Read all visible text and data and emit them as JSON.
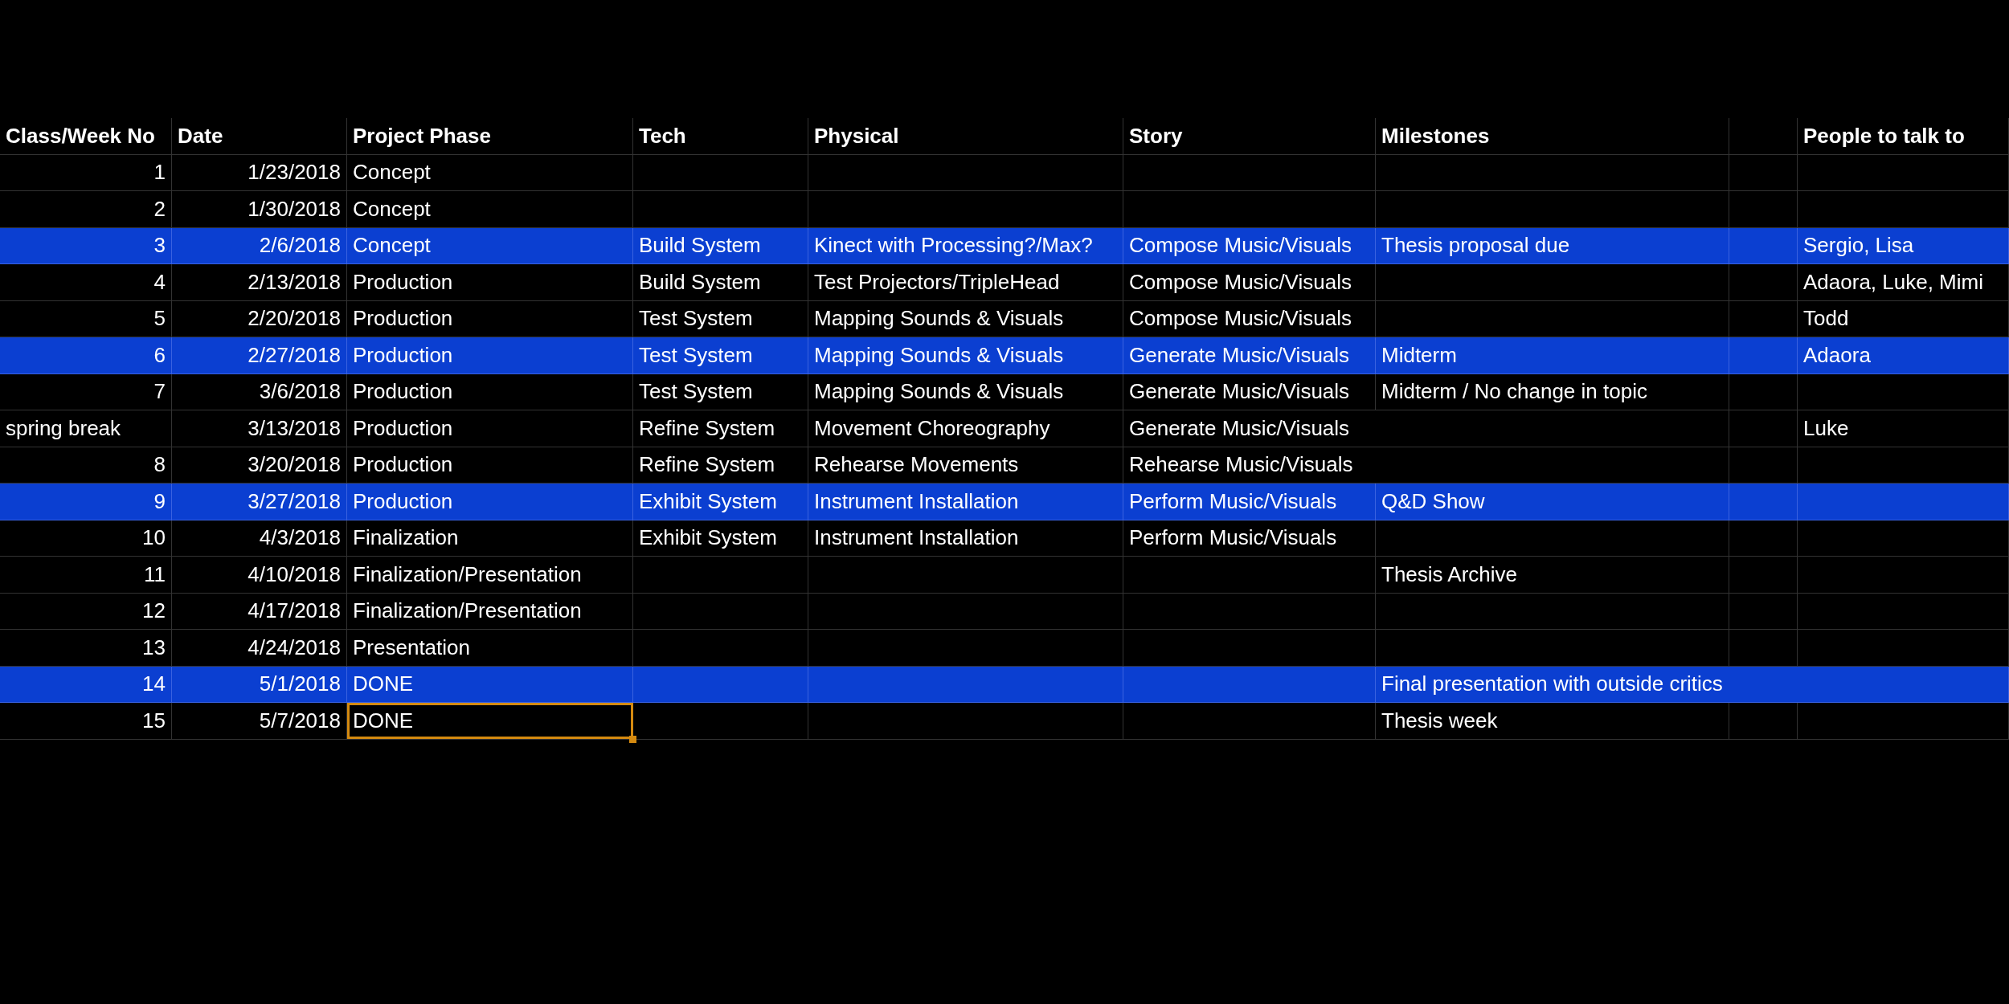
{
  "table": {
    "columns": [
      "Class/Week No",
      "Date",
      "Project Phase",
      "Tech",
      "Physical",
      "Story",
      "Milestones",
      "People to talk to"
    ],
    "rows": [
      {
        "kind": "week",
        "week": "1",
        "date": "1/23/2018",
        "phase": "Concept",
        "highlighted": false,
        "phase_selected": false
      },
      {
        "kind": "week",
        "week": "2",
        "date": "1/30/2018",
        "phase": "Concept",
        "highlighted": false,
        "phase_selected": false
      },
      {
        "kind": "week",
        "week": "3",
        "date": "2/6/2018",
        "phase": "Concept",
        "tech": "Build System",
        "physical": "Kinect with Processing?/Max?",
        "story": "Compose Music/Visuals",
        "milestones": "Thesis proposal due",
        "people": "Sergio, Lisa",
        "highlighted": true,
        "phase_selected": false
      },
      {
        "kind": "week",
        "week": "4",
        "date": "2/13/2018",
        "phase": "Production",
        "tech": "Build System",
        "physical": "Test Projectors/TripleHead",
        "story": "Compose Music/Visuals",
        "people": "Adaora, Luke, Mimi",
        "highlighted": false,
        "phase_selected": false
      },
      {
        "kind": "week",
        "week": "5",
        "date": "2/20/2018",
        "phase": "Production",
        "tech": "Test System",
        "physical": "Mapping Sounds & Visuals",
        "story": "Compose Music/Visuals",
        "people": "Todd",
        "highlighted": false,
        "phase_selected": false
      },
      {
        "kind": "week",
        "week": "6",
        "date": "2/27/2018",
        "phase": "Production",
        "tech": "Test System",
        "physical": "Mapping Sounds & Visuals",
        "story": "Generate Music/Visuals",
        "milestones": "Midterm",
        "people": "Adaora",
        "highlighted": true,
        "phase_selected": false
      },
      {
        "kind": "week",
        "week": "7",
        "date": "3/6/2018",
        "phase": "Production",
        "tech": "Test System",
        "physical": "Mapping Sounds & Visuals",
        "story": "Generate Music/Visuals",
        "milestones": "Midterm  / No change in topic",
        "highlighted": false,
        "phase_selected": false
      },
      {
        "kind": "break",
        "week": "spring break",
        "date": "3/13/2018",
        "phase": "Production",
        "tech": "Refine System",
        "physical": "Movement Choreography",
        "story": "Generate Music/Visuals",
        "people": "Luke",
        "highlighted": false,
        "phase_selected": false
      },
      {
        "kind": "week",
        "week": "8",
        "date": "3/20/2018",
        "phase": "Production",
        "tech": "Refine System",
        "physical": "Rehearse Movements",
        "story": "Rehearse Music/Visuals",
        "highlighted": false,
        "phase_selected": false
      },
      {
        "kind": "week",
        "week": "9",
        "date": "3/27/2018",
        "phase": "Production",
        "tech": "Exhibit System",
        "physical": "Instrument Installation",
        "story": "Perform Music/Visuals",
        "milestones": "Q&D Show",
        "highlighted": true,
        "phase_selected": false
      },
      {
        "kind": "week",
        "week": "10",
        "date": "4/3/2018",
        "phase": "Finalization",
        "tech": "Exhibit System",
        "physical": "Instrument Installation",
        "story": "Perform Music/Visuals",
        "highlighted": false,
        "phase_selected": false
      },
      {
        "kind": "week",
        "week": "11",
        "date": "4/10/2018",
        "phase": "Finalization/Presentation",
        "milestones": "Thesis Archive",
        "highlighted": false,
        "phase_selected": false
      },
      {
        "kind": "week",
        "week": "12",
        "date": "4/17/2018",
        "phase": "Finalization/Presentation",
        "highlighted": false,
        "phase_selected": false
      },
      {
        "kind": "week",
        "week": "13",
        "date": "4/24/2018",
        "phase": "Presentation",
        "highlighted": false,
        "phase_selected": false
      },
      {
        "kind": "week",
        "week": "14",
        "date": "5/1/2018",
        "phase": "DONE",
        "milestones": "Final presentation with outside critics",
        "highlighted": true,
        "phase_selected": false
      },
      {
        "kind": "week",
        "week": "15",
        "date": "5/7/2018",
        "phase": "DONE",
        "milestones": "Thesis week",
        "highlighted": false,
        "phase_selected": true
      }
    ]
  }
}
